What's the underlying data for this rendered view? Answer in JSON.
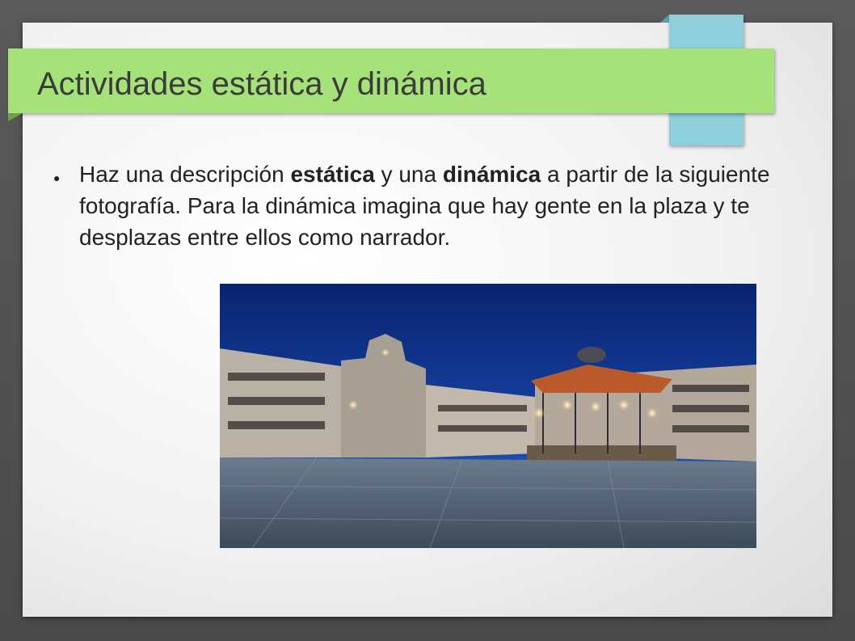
{
  "slide": {
    "title": "Actividades estática y dinámica",
    "bullet_symbol": "●",
    "body": {
      "part1": "Haz una descripción ",
      "bold1": "estática",
      "part2": " y una ",
      "bold2": "dinámica",
      "part3": " a partir de la siguiente fotografía. Para la dinámica imagina que hay gente en la plaza y te desplazas entre ellos como narrador."
    }
  },
  "colors": {
    "title_band": "#a6e27a",
    "accent_tab": "#8fcedb",
    "sky": "#0f2a6a"
  }
}
